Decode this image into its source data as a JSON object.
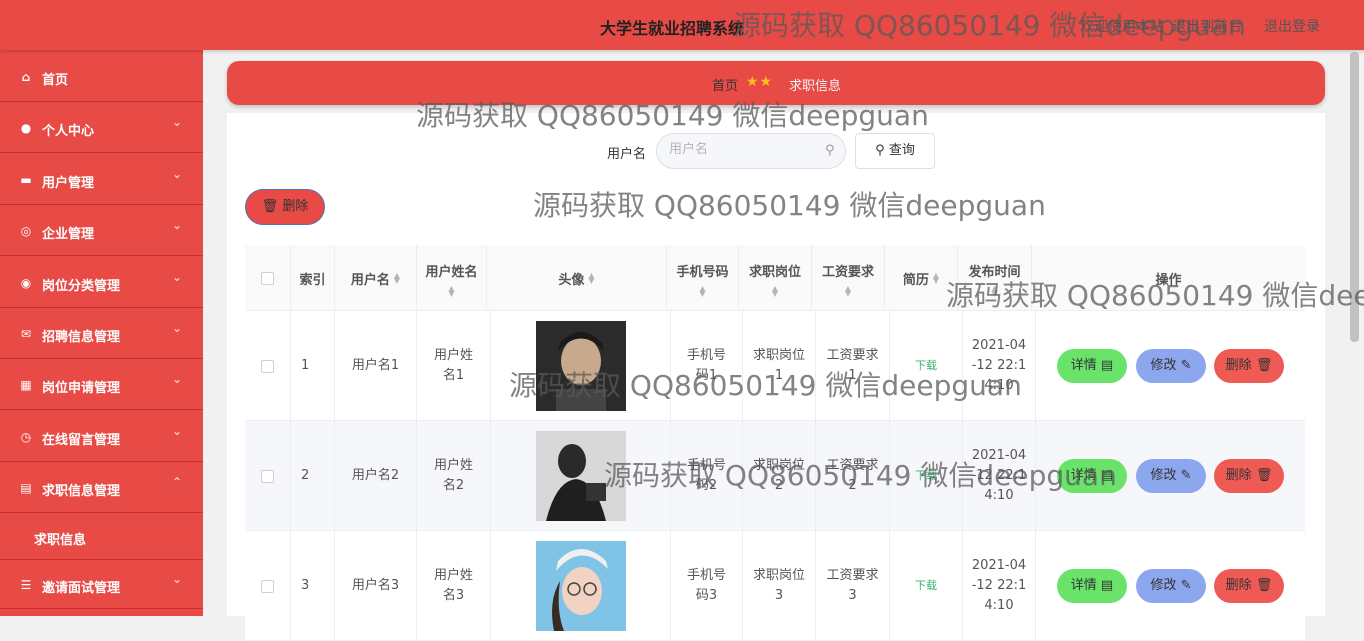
{
  "header": {
    "title": "大学生就业招聘系统",
    "watermark": "源码获取 QQ86050149 微信deepguan",
    "links": [
      "欢迎使用本站",
      "退出到前台",
      "退出登录"
    ]
  },
  "sidebar": {
    "items": [
      {
        "label": "首页",
        "icon": "home-icon"
      },
      {
        "label": "个人中心",
        "icon": "user-icon"
      },
      {
        "label": "用户管理",
        "icon": "briefcase-icon"
      },
      {
        "label": "企业管理",
        "icon": "compass-icon"
      },
      {
        "label": "岗位分类管理",
        "icon": "circle-icon"
      },
      {
        "label": "招聘信息管理",
        "icon": "mail-icon"
      },
      {
        "label": "岗位申请管理",
        "icon": "calendar-icon"
      },
      {
        "label": "在线留言管理",
        "icon": "clock-icon"
      },
      {
        "label": "求职信息管理",
        "icon": "document-icon"
      },
      {
        "label": "邀请面试管理",
        "icon": "sliders-icon"
      }
    ],
    "submenu": [
      "求职信息"
    ]
  },
  "breadcrumb": {
    "home": "首页",
    "stars": "★★",
    "current": "求职信息"
  },
  "search": {
    "label": "用户名",
    "placeholder": "用户名",
    "button": "查询"
  },
  "toolbar": {
    "delete_label": "删除"
  },
  "table": {
    "headers": [
      "索引",
      "用户名",
      "用户姓名",
      "头像",
      "手机号码",
      "求职岗位",
      "工资要求",
      "简历",
      "发布时间",
      "操作"
    ],
    "rows": [
      {
        "index": "1",
        "username": "用户名1",
        "realname": "用户姓名1",
        "phone": "手机号码1",
        "job": "求职岗位1",
        "salary": "工资要求1",
        "resume": "下载",
        "time": "2021-04-12 22:14:10"
      },
      {
        "index": "2",
        "username": "用户名2",
        "realname": "用户姓名2",
        "phone": "手机号码2",
        "job": "求职岗位2",
        "salary": "工资要求2",
        "resume": "下载",
        "time": "2021-04-12 22:14:10"
      },
      {
        "index": "3",
        "username": "用户名3",
        "realname": "用户姓名3",
        "phone": "手机号码3",
        "job": "求职岗位3",
        "salary": "工资要求3",
        "resume": "下载",
        "time": "2021-04-12 22:14:10"
      }
    ],
    "actions": {
      "detail": "详情",
      "edit": "修改",
      "delete": "删除"
    }
  }
}
